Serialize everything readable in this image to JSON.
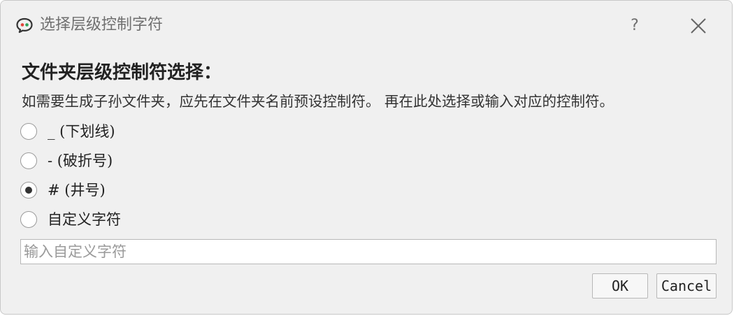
{
  "window": {
    "title": "选择层级控制字符",
    "help_label": "?"
  },
  "dialog": {
    "heading": "文件夹层级控制符选择：",
    "description": "如需要生成子孙文件夹，应先在文件夹名前预设控制符。 再在此处选择或输入对应的控制符。",
    "options": [
      {
        "label": "_ (下划线)",
        "checked": false
      },
      {
        "label": "- (破折号)",
        "checked": false
      },
      {
        "label": "# (井号)",
        "checked": true
      },
      {
        "label": "自定义字符",
        "checked": false
      }
    ],
    "custom_input": {
      "value": "",
      "placeholder": "输入自定义字符"
    },
    "ok_label": "OK",
    "cancel_label": "Cancel"
  },
  "icons": {
    "app": "speech-bubble-icon",
    "close": "close-icon"
  },
  "colors": {
    "icon_red": "#e0443a",
    "icon_green": "#2fa35a",
    "icon_dark": "#333333"
  }
}
